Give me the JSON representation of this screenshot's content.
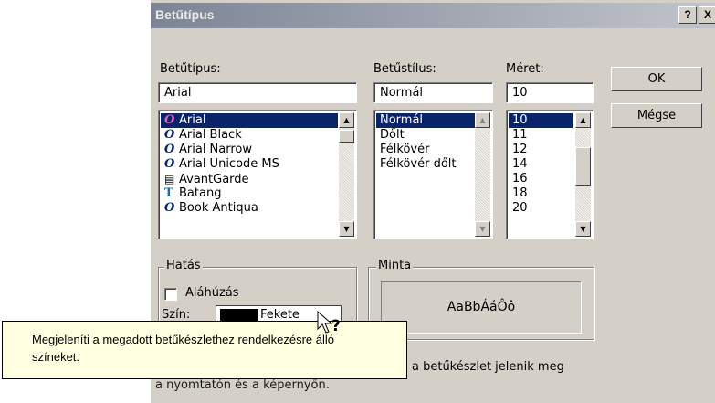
{
  "dialog": {
    "title": "Betűtípus",
    "help_button": "?",
    "close_button": "X"
  },
  "font": {
    "label": "Betűtípus:",
    "value": "Arial",
    "items": [
      {
        "name": "Arial",
        "icon": "opentype-font-icon"
      },
      {
        "name": "Arial Black",
        "icon": "opentype-font-icon"
      },
      {
        "name": "Arial Narrow",
        "icon": "opentype-font-icon"
      },
      {
        "name": "Arial Unicode MS",
        "icon": "opentype-font-icon"
      },
      {
        "name": "AvantGarde",
        "icon": "printer-font-icon"
      },
      {
        "name": "Batang",
        "icon": "truetype-font-icon"
      },
      {
        "name": "Book Antiqua",
        "icon": "opentype-font-icon"
      }
    ],
    "selected": "Arial"
  },
  "style": {
    "label": "Betűstílus:",
    "value": "Normál",
    "items": [
      "Normál",
      "Dőlt",
      "Félkövér",
      "Félkövér dőlt"
    ],
    "selected": "Normál"
  },
  "size": {
    "label": "Méret:",
    "value": "10",
    "items": [
      "10",
      "11",
      "12",
      "14",
      "16",
      "18",
      "20"
    ],
    "selected": "10"
  },
  "buttons": {
    "ok": "OK",
    "cancel": "Mégse"
  },
  "effects": {
    "label": "Hatás",
    "underline": "Aláhúzás",
    "color_label": "Szín:",
    "color_value": "Fekete",
    "color_swatch": "#000000"
  },
  "sample": {
    "label": "Minta",
    "text": "AaBbÁáÔô"
  },
  "info_text": "a betűkészlet jelenik meg",
  "obscured_text": "a nyomtatón és a képernyőn.",
  "tooltip": {
    "line1": "Megjeleníti a megadott betűkészlethez rendelkezésre álló",
    "line2": "színeket."
  },
  "colors": {
    "dialog_bg": "#d4d0c8",
    "selection": "#0a246a",
    "tooltip_bg": "#ffffe1"
  }
}
